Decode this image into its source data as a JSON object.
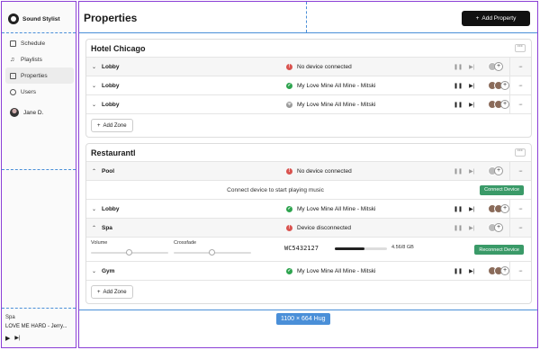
{
  "sidebar": {
    "brand": "Sound Stylist",
    "nav": [
      {
        "label": "Schedule"
      },
      {
        "label": "Playlists"
      },
      {
        "label": "Properties"
      },
      {
        "label": "Users"
      }
    ],
    "user": {
      "name": "Jane D."
    },
    "player": {
      "location": "Spa",
      "track": "LOVE ME HARD - Jerry...",
      "play": "▶",
      "next": "▶|"
    }
  },
  "header": {
    "title": "Properties",
    "add_label": "Add Property"
  },
  "properties": [
    {
      "name": "Hotel Chicago",
      "zones": [
        {
          "name": "Lobby",
          "status": "No device connected",
          "status_type": "error"
        },
        {
          "name": "Lobby",
          "status": "My Love Mine All Mine - Mitski",
          "status_type": "ok"
        },
        {
          "name": "Lobby",
          "status": "My Love Mine All Mine - Mitski",
          "status_type": "warn"
        }
      ],
      "add_zone": "Add Zone"
    },
    {
      "name": "Restaurantl",
      "zones": [
        {
          "name": "Pool",
          "status": "No device connected",
          "status_type": "error",
          "banner": "Connect device to start playing music",
          "banner_button": "Connect Device"
        },
        {
          "name": "Lobby",
          "status": "My Love Mine All Mine - Mitski",
          "status_type": "ok"
        },
        {
          "name": "Spa",
          "status": "Device disconnected",
          "status_type": "error",
          "volume_label": "Volume",
          "volume_level": 0.5,
          "crossfade_label": "Crossfade",
          "crossfade_level": 0.5,
          "serial": "WC5432127",
          "storage": "4.56/8 GB",
          "storage_fraction": 0.57,
          "detail_button": "Reconnect Device"
        },
        {
          "name": "Gym",
          "status": "My Love Mine All Mine - Mitski",
          "status_type": "ok"
        }
      ],
      "add_zone": "Add Zone"
    }
  ],
  "size_chip": "1100 × 664 Hug",
  "colors": {
    "accent": "#111111",
    "success": "#3a9a68",
    "error": "#d9534f",
    "selection": "#8b3fd6",
    "guide": "#4a8fd8"
  }
}
